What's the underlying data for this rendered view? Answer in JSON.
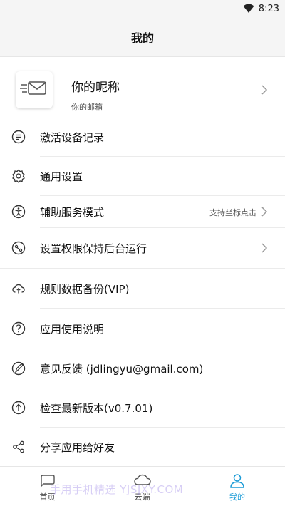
{
  "status_bar": {
    "time": "8:23",
    "wifi_icon": "wifi-icon"
  },
  "header": {
    "title": "我的"
  },
  "profile": {
    "nickname": "你的昵称",
    "email": "你的邮箱",
    "avatar_icon": "mail-icon"
  },
  "menu": [
    {
      "label": "激活设备记录",
      "icon": "list-icon",
      "extra": ""
    },
    {
      "label": "通用设置",
      "icon": "gear-icon",
      "extra": ""
    },
    {
      "label": "辅助服务模式",
      "icon": "accessibility-icon",
      "extra": "支持坐标点击"
    },
    {
      "label": "设置权限保持后台运行",
      "icon": "run-background-icon",
      "extra": ""
    },
    {
      "label": "规则数据备份(VIP)",
      "icon": "cloud-upload-icon",
      "extra": ""
    },
    {
      "label": "应用使用说明",
      "icon": "help-icon",
      "extra": ""
    },
    {
      "label": "意见反馈 (jdlingyu@gmail.com)",
      "icon": "feedback-icon",
      "extra": ""
    },
    {
      "label": "检查最新版本(v0.7.01)",
      "icon": "update-icon",
      "extra": ""
    },
    {
      "label": "分享应用给好友",
      "icon": "share-icon",
      "extra": ""
    }
  ],
  "tabs": [
    {
      "label": "首页",
      "icon": "home-icon"
    },
    {
      "label": "云端",
      "icon": "cloud-icon"
    },
    {
      "label": "我的",
      "icon": "user-icon"
    }
  ],
  "watermark": "手用手机精选 YJSJXY.COM",
  "colors": {
    "accent": "#1a9bd7",
    "background": "#f5f5f5"
  }
}
